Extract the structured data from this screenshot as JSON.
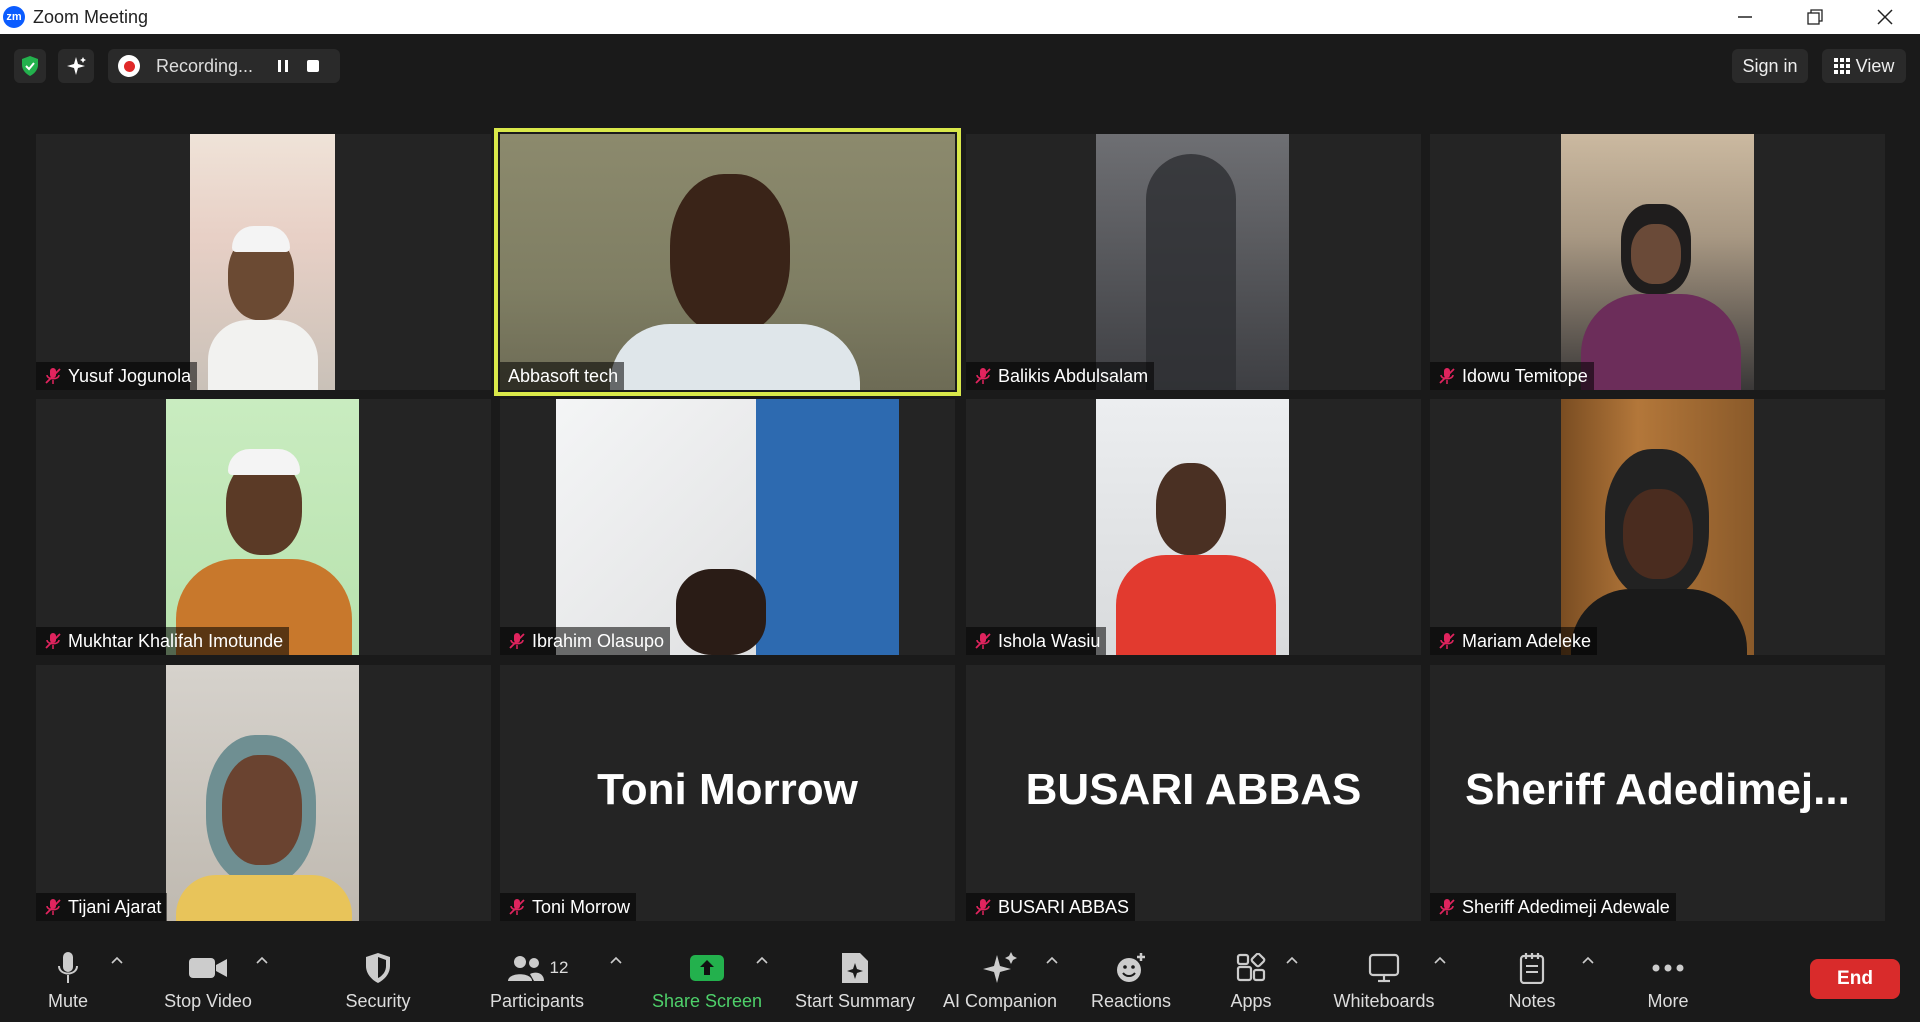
{
  "window": {
    "app_icon_text": "zm",
    "title": "Zoom Meeting"
  },
  "topbar": {
    "recording_label": "Recording...",
    "sign_in_label": "Sign in",
    "view_label": "View"
  },
  "colors": {
    "active_speaker_border": "#d9e84a",
    "end_button": "#d92b2b",
    "share_screen": "#23b14d",
    "muted_mic": "#e0245e"
  },
  "participants": [
    {
      "name": "Yusuf Jogunola",
      "muted": true,
      "video": true
    },
    {
      "name": "Abbasoft tech",
      "muted": false,
      "video": true,
      "active_speaker": true
    },
    {
      "name": "Balikis Abdulsalam",
      "muted": true,
      "video": true
    },
    {
      "name": "Idowu Temitope",
      "muted": true,
      "video": true
    },
    {
      "name": "Mukhtar Khalifah Imotunde",
      "muted": true,
      "video": true
    },
    {
      "name": "Ibrahim Olasupo",
      "muted": true,
      "video": true
    },
    {
      "name": "Ishola Wasiu",
      "muted": true,
      "video": true
    },
    {
      "name": "Mariam Adeleke",
      "muted": true,
      "video": true
    },
    {
      "name": "Tijani Ajarat",
      "muted": true,
      "video": true
    },
    {
      "name": "Toni Morrow",
      "muted": true,
      "video": false,
      "display_name": "Toni Morrow"
    },
    {
      "name": "BUSARI ABBAS",
      "muted": true,
      "video": false,
      "display_name": "BUSARI ABBAS"
    },
    {
      "name": "Sheriff Adedimeji Adewale",
      "muted": true,
      "video": false,
      "display_name": "Sheriff  Adedimej..."
    }
  ],
  "bottombar": {
    "mute_label": "Mute",
    "stop_video_label": "Stop Video",
    "security_label": "Security",
    "participants_label": "Participants",
    "participants_count": "12",
    "share_screen_label": "Share Screen",
    "start_summary_label": "Start Summary",
    "ai_companion_label": "AI Companion",
    "reactions_label": "Reactions",
    "apps_label": "Apps",
    "whiteboards_label": "Whiteboards",
    "notes_label": "Notes",
    "more_label": "More",
    "end_label": "End"
  }
}
